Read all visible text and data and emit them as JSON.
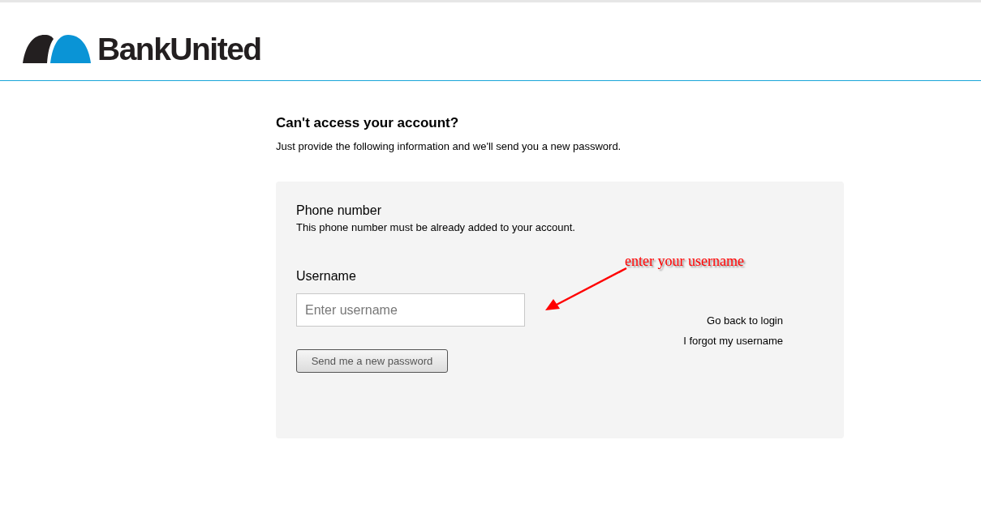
{
  "header": {
    "logo_text": "BankUnited"
  },
  "heading": "Can't access your account?",
  "intro": "Just provide the following information and we'll send you a new password.",
  "form": {
    "phone_label": "Phone number",
    "phone_hint": "This phone number must be already added to your account.",
    "username_label": "Username",
    "username_placeholder": "Enter username",
    "submit": "Send me a new password",
    "links": [
      "Go back to login",
      "I forgot my username"
    ]
  },
  "annotation": {
    "text": "enter your username"
  }
}
